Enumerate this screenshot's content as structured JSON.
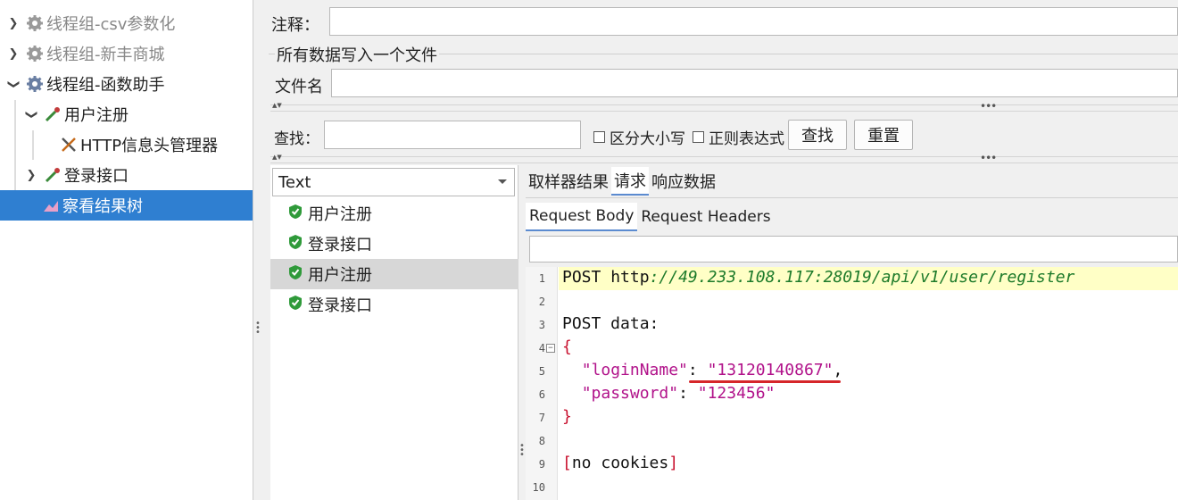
{
  "tree": {
    "items": [
      {
        "label": "线程组-csv参数化",
        "disabled": true
      },
      {
        "label": "线程组-新丰商城",
        "disabled": true
      },
      {
        "label": "线程组-函数助手",
        "disabled": false
      },
      {
        "label": "用户注册"
      },
      {
        "label": "HTTP信息头管理器"
      },
      {
        "label": "登录接口"
      },
      {
        "label": "察看结果树",
        "selected": true
      }
    ]
  },
  "form": {
    "comment_label": "注释：",
    "comment_value": "",
    "group_title": "所有数据写入一个文件",
    "filename_label": "文件名",
    "filename_value": ""
  },
  "search": {
    "label": "查找：",
    "value": "",
    "case_label": "区分大小写",
    "regex_label": "正则表达式",
    "find_button": "查找",
    "reset_button": "重置"
  },
  "results": {
    "renderer": "Text",
    "items": [
      {
        "label": "用户注册",
        "selected": false
      },
      {
        "label": "登录接口",
        "selected": false
      },
      {
        "label": "用户注册",
        "selected": true
      },
      {
        "label": "登录接口",
        "selected": false
      }
    ]
  },
  "detail": {
    "tabs": [
      "取样器结果",
      "请求",
      "响应数据"
    ],
    "active_tab": "请求",
    "subtabs": [
      "Request Body",
      "Request Headers"
    ],
    "active_subtab": "Request Body",
    "code": {
      "line_numbers": [
        "1",
        "2",
        "3",
        "4",
        "5",
        "6",
        "7",
        "8",
        "9",
        "10"
      ],
      "method": "POST",
      "url_scheme": "http",
      "url_rest": "://49.233.108.117:28019/api/v1/user/register",
      "post_data_label": "POST data:",
      "open_brace": "{",
      "key1": "\"loginName\"",
      "val1": "\"13120140867\"",
      "key2": "\"password\"",
      "val2": "\"123456\"",
      "close_brace": "}",
      "cookies_open": "[",
      "cookies_text": "no cookies",
      "cookies_close": "]"
    }
  },
  "colors": {
    "selection": "#2f7fd1",
    "url": "#1d7a2a",
    "json": "#b1128a",
    "bracket": "#c8102e",
    "underline": "#d6262a",
    "highlight_line": "#ffffc6"
  }
}
